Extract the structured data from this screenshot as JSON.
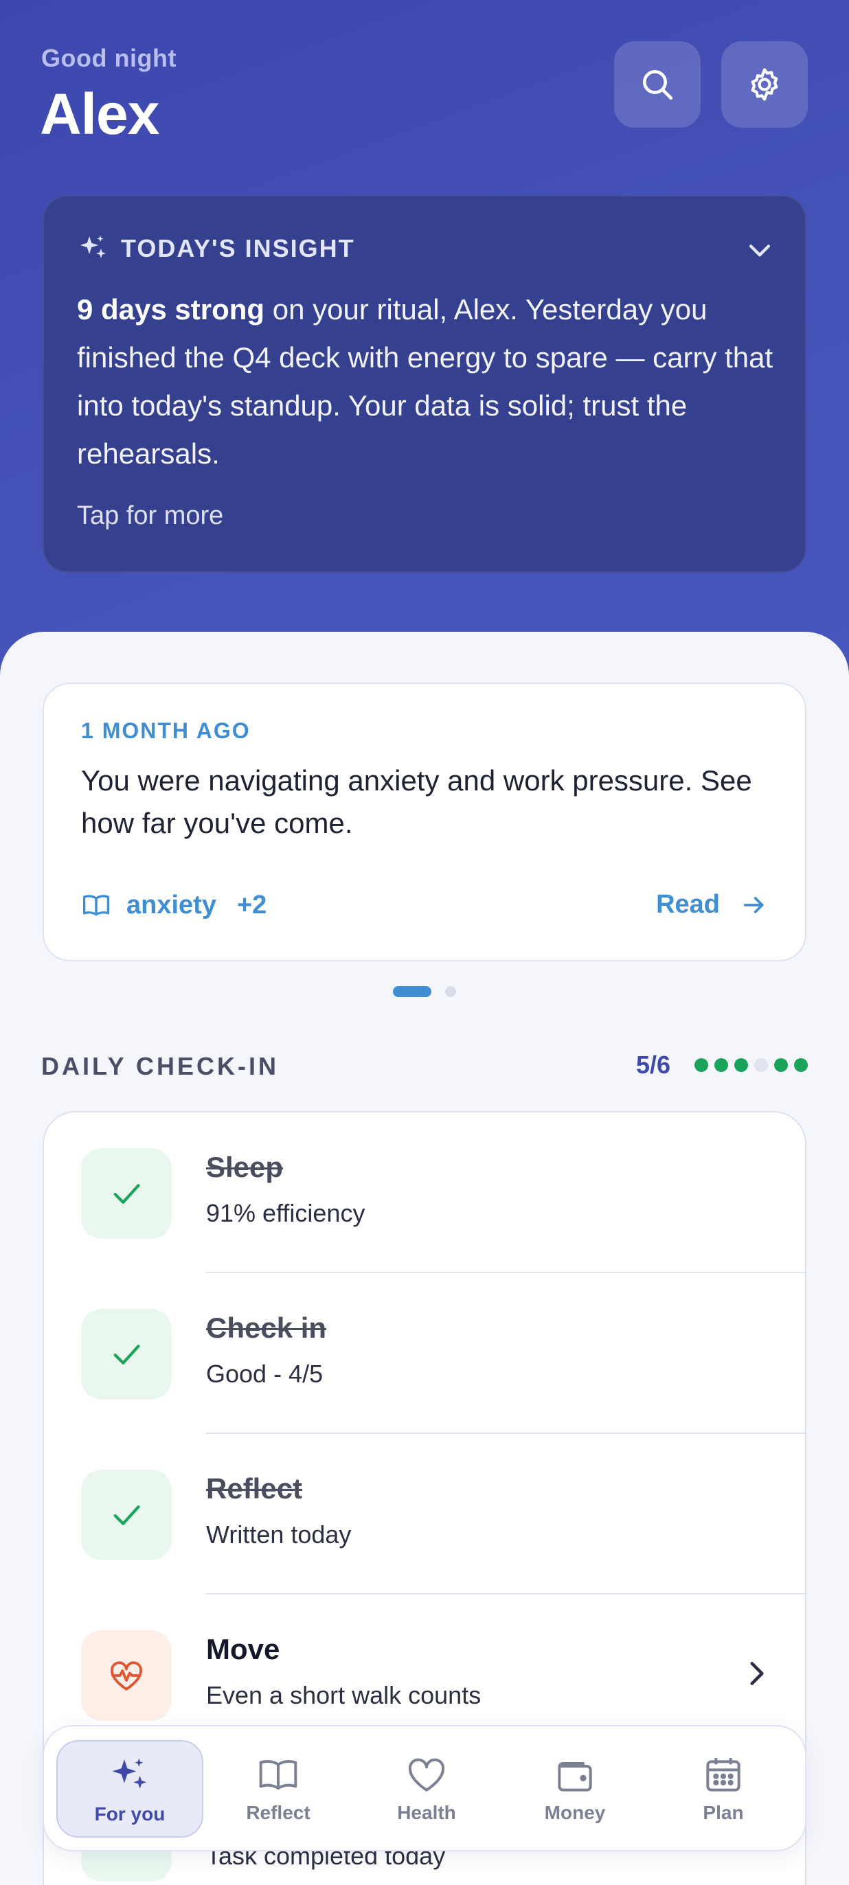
{
  "header": {
    "greeting": "Good night",
    "name": "Alex"
  },
  "insight": {
    "title": "TODAY'S INSIGHT",
    "highlight": "9 days strong",
    "body": " on your ritual, Alex. Yesterday you finished the Q4 deck with energy to spare — carry that into today's standup. Your data is solid; trust the rehearsals.",
    "more": "Tap for more"
  },
  "memory": {
    "when": "1 MONTH AGO",
    "text": "You were navigating anxiety and work pressure. See how far you've come.",
    "tag": "anxiety",
    "tag_more": "+2",
    "read": "Read"
  },
  "pager": {
    "current": 1,
    "total": 2
  },
  "checkin": {
    "label": "DAILY CHECK-IN",
    "progress": "5/6",
    "done_color": "#1aa35a",
    "pending_color": "#dfe2ef",
    "dots": [
      true,
      true,
      true,
      false,
      true,
      true
    ],
    "rows": [
      {
        "title": "Sleep",
        "sub": "91% efficiency",
        "done": true,
        "icon": "check-icon"
      },
      {
        "title": "Check in",
        "sub": "Good - 4/5",
        "done": true,
        "icon": "check-icon"
      },
      {
        "title": "Reflect",
        "sub": "Written today",
        "done": true,
        "icon": "check-icon"
      },
      {
        "title": "Move",
        "sub": "Even a short walk counts",
        "done": false,
        "icon": "heart-pulse-icon"
      },
      {
        "title": "",
        "sub": "Task completed today",
        "done": true,
        "icon": "check-icon"
      }
    ]
  },
  "nav": {
    "items": [
      {
        "label": "For you",
        "icon": "sparkles-icon",
        "active": true
      },
      {
        "label": "Reflect",
        "icon": "book-icon",
        "active": false
      },
      {
        "label": "Health",
        "icon": "heart-icon",
        "active": false
      },
      {
        "label": "Money",
        "icon": "wallet-icon",
        "active": false
      },
      {
        "label": "Plan",
        "icon": "calendar-icon",
        "active": false
      }
    ]
  },
  "colors": {
    "accent": "#3f4aa8",
    "link": "#3f8ed3",
    "success": "#1aa35a",
    "warning": "#e0552f"
  }
}
